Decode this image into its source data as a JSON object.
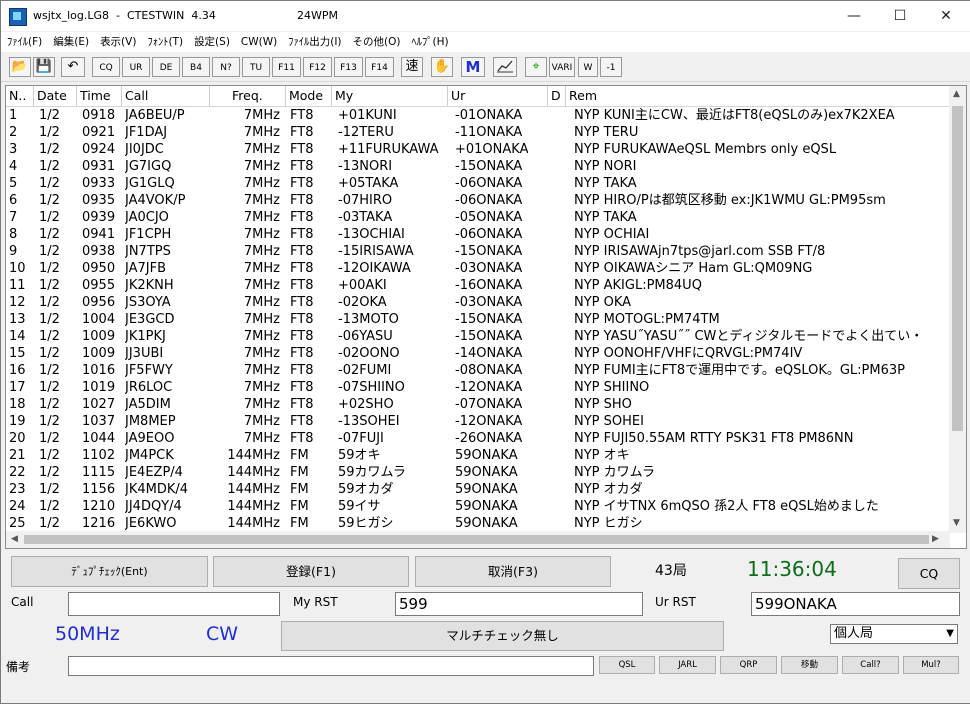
{
  "window": {
    "title": "wsjtx_log.LG8  -  CTESTWIN  4.34",
    "subtitle": "24WPM",
    "minimize_glyph": "—",
    "maximize_glyph": "☐",
    "close_glyph": "✕"
  },
  "menu": [
    "ﾌｧｲﾙ(F)",
    "編集(E)",
    "表示(V)",
    "ﾌｫﾝﾄ(T)",
    "設定(S)",
    "CW(W)",
    "ﾌｧｲﾙ出力(I)",
    "その他(O)",
    "ﾍﾙﾌﾟ(H)"
  ],
  "toolbar": {
    "cq": "CQ",
    "ur": "UR",
    "de": "DE",
    "b4": "B4",
    "nq": "N?",
    "tu": "TU",
    "f11": "F11",
    "f12": "F12",
    "f13": "F13",
    "f14": "F14",
    "speed": "速",
    "hand": "✋",
    "m": "M",
    "graph": "📈",
    "target": "⌖",
    "vari": "VARI",
    "w": "W",
    "minus1": "-1"
  },
  "columns": [
    "N..",
    "Date",
    "Time",
    "Call",
    "Freq.",
    "Mode",
    "My",
    "Ur",
    "D",
    "Rem"
  ],
  "rows": [
    [
      "1",
      "1/2",
      "0918",
      "JA6BEU/P",
      "7MHz",
      "FT8",
      "+01KUNI",
      "-01ONAKA",
      "",
      "NYP KUNI主にCW、最近はFT8(eQSLのみ)ex7K2XEA"
    ],
    [
      "2",
      "1/2",
      "0921",
      "JF1DAJ",
      "7MHz",
      "FT8",
      "-12TERU",
      "-11ONAKA",
      "",
      "NYP TERU"
    ],
    [
      "3",
      "1/2",
      "0924",
      "JI0JDC",
      "7MHz",
      "FT8",
      "+11FURUKAWA",
      "+01ONAKA",
      "",
      "NYP FURUKAWAeQSL Membrs only eQSL"
    ],
    [
      "4",
      "1/2",
      "0931",
      "JG7IGQ",
      "7MHz",
      "FT8",
      "-13NORI",
      "-15ONAKA",
      "",
      "NYP NORI"
    ],
    [
      "5",
      "1/2",
      "0933",
      "JG1GLQ",
      "7MHz",
      "FT8",
      "+05TAKA",
      "-06ONAKA",
      "",
      "NYP TAKA"
    ],
    [
      "6",
      "1/2",
      "0935",
      "JA4VOK/P",
      "7MHz",
      "FT8",
      "-07HIRO",
      "-06ONAKA",
      "",
      "NYP HIRO/Pは都筑区移動 ex:JK1WMU GL:PM95sm"
    ],
    [
      "7",
      "1/2",
      "0939",
      "JA0CJO",
      "7MHz",
      "FT8",
      "-03TAKA",
      "-05ONAKA",
      "",
      "NYP TAKA"
    ],
    [
      "8",
      "1/2",
      "0941",
      "JF1CPH",
      "7MHz",
      "FT8",
      "-13OCHIAI",
      "-06ONAKA",
      "",
      "NYP OCHIAI"
    ],
    [
      "9",
      "1/2",
      "0938",
      "JN7TPS",
      "7MHz",
      "FT8",
      "-15IRISAWA",
      "-15ONAKA",
      "",
      "NYP IRISAWAjn7tps@jarl.com SSB FT/8"
    ],
    [
      "10",
      "1/2",
      "0950",
      "JA7JFB",
      "7MHz",
      "FT8",
      "-12OIKAWA",
      "-03ONAKA",
      "",
      "NYP OIKAWAシニア Ham     GL:QM09NG"
    ],
    [
      "11",
      "1/2",
      "0955",
      "JK2KNH",
      "7MHz",
      "FT8",
      "+00AKI",
      "-16ONAKA",
      "",
      "NYP AKIGL:PM84UQ"
    ],
    [
      "12",
      "1/2",
      "0956",
      "JS3OYA",
      "7MHz",
      "FT8",
      "-02OKA",
      "-03ONAKA",
      "",
      "NYP OKA"
    ],
    [
      "13",
      "1/2",
      "1004",
      "JE3GCD",
      "7MHz",
      "FT8",
      "-13MOTO",
      "-15ONAKA",
      "",
      "NYP MOTOGL:PM74TM"
    ],
    [
      "14",
      "1/2",
      "1009",
      "JK1PKJ",
      "7MHz",
      "FT8",
      "-06YASU",
      "-15ONAKA",
      "",
      "NYP YASU˝YASU˝˝ CWとディジタルモードでよく出てい・"
    ],
    [
      "15",
      "1/2",
      "1009",
      "JJ3UBI",
      "7MHz",
      "FT8",
      "-02OONO",
      "-14ONAKA",
      "",
      "NYP OONOHF/VHFにQRVGL:PM74IV"
    ],
    [
      "16",
      "1/2",
      "1016",
      "JF5FWY",
      "7MHz",
      "FT8",
      "-02FUMI",
      "-08ONAKA",
      "",
      "NYP FUMI主にFT8で運用中です。eQSLOK。GL:PM63P"
    ],
    [
      "17",
      "1/2",
      "1019",
      "JR6LOC",
      "7MHz",
      "FT8",
      "-07SHIINO",
      "-12ONAKA",
      "",
      "NYP SHIINO"
    ],
    [
      "18",
      "1/2",
      "1027",
      "JA5DIM",
      "7MHz",
      "FT8",
      "+02SHO",
      "-07ONAKA",
      "",
      "NYP SHO"
    ],
    [
      "19",
      "1/2",
      "1037",
      "JM8MEP",
      "7MHz",
      "FT8",
      "-13SOHEI",
      "-12ONAKA",
      "",
      "NYP SOHEI"
    ],
    [
      "20",
      "1/2",
      "1044",
      "JA9EOO",
      "7MHz",
      "FT8",
      "-07FUJI",
      "-26ONAKA",
      "",
      "NYP FUJI50.55AM RTTY PSK31 FT8 PM86NN"
    ],
    [
      "21",
      "1/2",
      "1102",
      "JM4PCK",
      "144MHz",
      "FM",
      "59オキ",
      "59ONAKA",
      "",
      "NYP オキ"
    ],
    [
      "22",
      "1/2",
      "1115",
      "JE4EZP/4",
      "144MHz",
      "FM",
      "59カワムラ",
      "59ONAKA",
      "",
      "NYP カワムラ"
    ],
    [
      "23",
      "1/2",
      "1156",
      "JK4MDK/4",
      "144MHz",
      "FM",
      "59オカダ",
      "59ONAKA",
      "",
      "NYP オカダ"
    ],
    [
      "24",
      "1/2",
      "1210",
      "JJ4DQY/4",
      "144MHz",
      "FM",
      "59イサ",
      "59ONAKA",
      "",
      "NYP イサTNX 6mQSO 孫2人 FT8 eQSL始めました"
    ],
    [
      "25",
      "1/2",
      "1216",
      "JE6KWO",
      "144MHz",
      "FM",
      "59ヒガシ",
      "59ONAKA",
      "",
      "NYP ヒガシ"
    ]
  ],
  "bottom": {
    "dupe_button": "ﾃﾞｭﾌﾟﾁｪｯｸ(Ent)",
    "register_button": "登録(F1)",
    "cancel_button": "取消(F3)",
    "station_count": "43局",
    "clock": "11:36:04",
    "cq_button": "CQ",
    "call_label": "Call",
    "call_value": "",
    "myrst_label": "My RST",
    "myrst_value": "599",
    "urrst_label": "Ur RST",
    "urrst_value": "599ONAKA",
    "band": "50MHz",
    "mode": "CW",
    "multi_button": "マルチチェック無し",
    "station_type": "個人局",
    "remark_label": "備考",
    "remark_value": "",
    "qsl": "QSL",
    "jarl": "JARL",
    "qrp": "QRP",
    "move": "移動",
    "callq": "Call?",
    "mulq": "Mul?"
  },
  "colors": {
    "clock": "#0a6e18",
    "band_mode": "#1f2fd6",
    "m_icon": "#1f2fd6"
  }
}
